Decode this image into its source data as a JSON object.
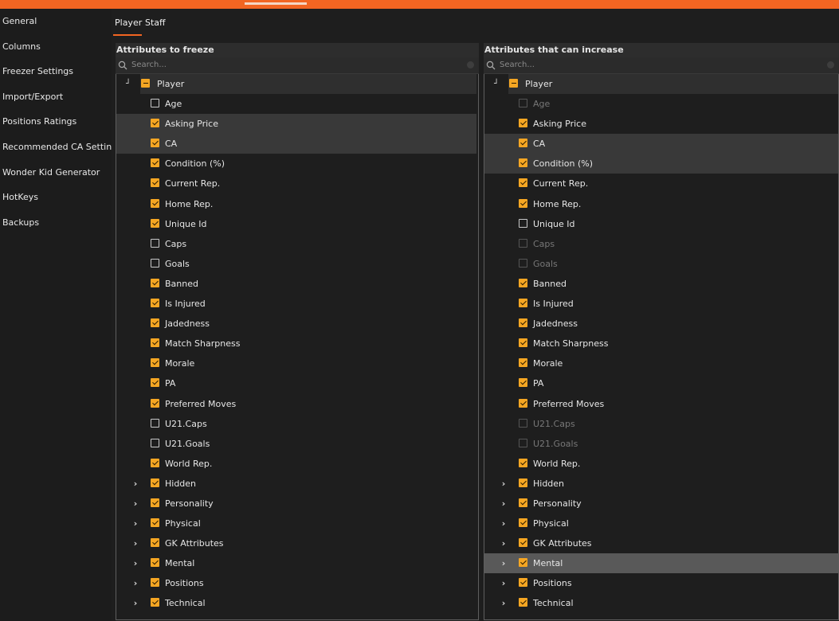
{
  "sidebar": {
    "items": [
      "General",
      "Columns",
      "Freezer Settings",
      "Import/Export",
      "Positions Ratings",
      "Recommended CA Settings",
      "Wonder Kid Generator",
      "HotKeys",
      "Backups"
    ]
  },
  "tabs": {
    "player": "Player",
    "staff": "Staff",
    "active": "Player"
  },
  "left_panel": {
    "title": "Attributes to freeze",
    "search_placeholder": "Search...",
    "root": {
      "label": "Player",
      "state": "partial",
      "expanded": true
    },
    "items": [
      {
        "label": "Age",
        "checked": false
      },
      {
        "label": "Asking Price",
        "checked": true,
        "highlight": true
      },
      {
        "label": "CA",
        "checked": true,
        "highlight": true
      },
      {
        "label": "Condition (%)",
        "checked": true
      },
      {
        "label": "Current Rep.",
        "checked": true
      },
      {
        "label": "Home Rep.",
        "checked": true
      },
      {
        "label": "Unique Id",
        "checked": true
      },
      {
        "label": "Caps",
        "checked": false
      },
      {
        "label": "Goals",
        "checked": false
      },
      {
        "label": "Banned",
        "checked": true
      },
      {
        "label": "Is Injured",
        "checked": true
      },
      {
        "label": "Jadedness",
        "checked": true
      },
      {
        "label": "Match Sharpness",
        "checked": true
      },
      {
        "label": "Morale",
        "checked": true
      },
      {
        "label": "PA",
        "checked": true
      },
      {
        "label": "Preferred Moves",
        "checked": true
      },
      {
        "label": "U21.Caps",
        "checked": false
      },
      {
        "label": "U21.Goals",
        "checked": false
      },
      {
        "label": "World Rep.",
        "checked": true
      },
      {
        "label": "Hidden",
        "checked": true,
        "group": true
      },
      {
        "label": "Personality",
        "checked": true,
        "group": true
      },
      {
        "label": "Physical",
        "checked": true,
        "group": true
      },
      {
        "label": "GK Attributes",
        "checked": true,
        "group": true
      },
      {
        "label": "Mental",
        "checked": true,
        "group": true
      },
      {
        "label": "Positions",
        "checked": true,
        "group": true
      },
      {
        "label": "Technical",
        "checked": true,
        "group": true
      }
    ]
  },
  "right_panel": {
    "title": "Attributes that can increase",
    "search_placeholder": "Search...",
    "root": {
      "label": "Player",
      "state": "partial",
      "expanded": true
    },
    "items": [
      {
        "label": "Age",
        "checked": false,
        "disabled": true
      },
      {
        "label": "Asking Price",
        "checked": true
      },
      {
        "label": "CA",
        "checked": true,
        "highlight": true
      },
      {
        "label": "Condition (%)",
        "checked": true,
        "highlight": true
      },
      {
        "label": "Current Rep.",
        "checked": true
      },
      {
        "label": "Home Rep.",
        "checked": true
      },
      {
        "label": "Unique Id",
        "checked": false
      },
      {
        "label": "Caps",
        "checked": false,
        "disabled": true
      },
      {
        "label": "Goals",
        "checked": false,
        "disabled": true
      },
      {
        "label": "Banned",
        "checked": true
      },
      {
        "label": "Is Injured",
        "checked": true
      },
      {
        "label": "Jadedness",
        "checked": true
      },
      {
        "label": "Match Sharpness",
        "checked": true
      },
      {
        "label": "Morale",
        "checked": true
      },
      {
        "label": "PA",
        "checked": true
      },
      {
        "label": "Preferred Moves",
        "checked": true
      },
      {
        "label": "U21.Caps",
        "checked": false,
        "disabled": true
      },
      {
        "label": "U21.Goals",
        "checked": false,
        "disabled": true
      },
      {
        "label": "World Rep.",
        "checked": true
      },
      {
        "label": "Hidden",
        "checked": true,
        "group": true
      },
      {
        "label": "Personality",
        "checked": true,
        "group": true
      },
      {
        "label": "Physical",
        "checked": true,
        "group": true
      },
      {
        "label": "GK Attributes",
        "checked": true,
        "group": true
      },
      {
        "label": "Mental",
        "checked": true,
        "group": true,
        "hover": true
      },
      {
        "label": "Positions",
        "checked": true,
        "group": true
      },
      {
        "label": "Technical",
        "checked": true,
        "group": true
      }
    ]
  },
  "colors": {
    "accent": "#f26522",
    "checkbox": "#f5a623",
    "background": "#1c1c1c"
  }
}
